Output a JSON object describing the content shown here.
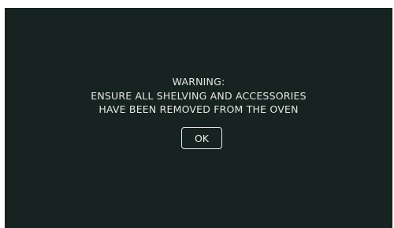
{
  "dialog": {
    "lines": [
      "WARNING:",
      "ENSURE ALL SHELVING AND ACCESSORIES",
      "HAVE BEEN REMOVED FROM THE OVEN"
    ],
    "ok_label": "OK"
  },
  "colors": {
    "screen_background": "#162320",
    "text": "#e6e6e6",
    "button_border": "#e8e8e8"
  }
}
